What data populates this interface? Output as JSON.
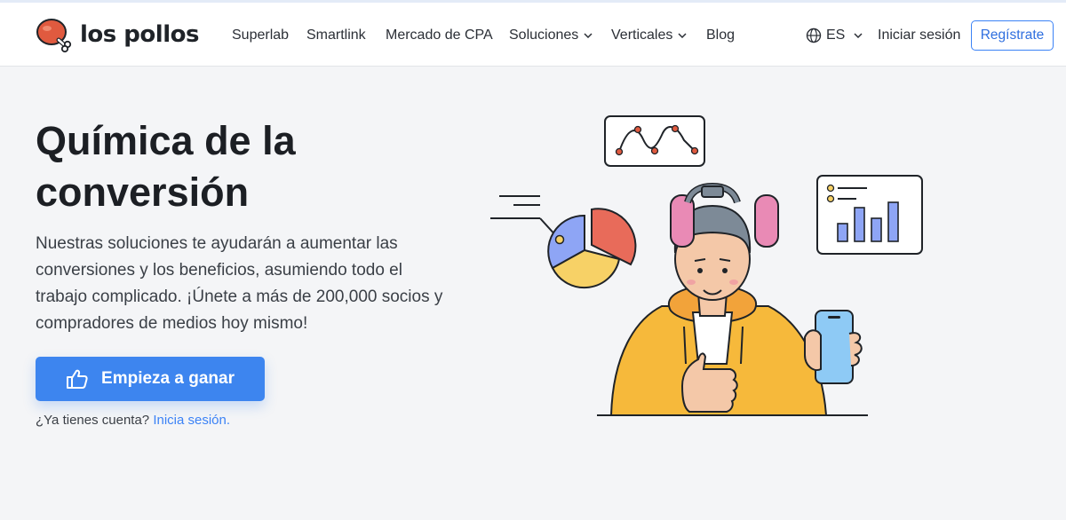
{
  "brand": {
    "name": "los pollos",
    "logo_icon": "chicken-leg-icon",
    "colors": {
      "logo_red": "#e05a3f",
      "accent_blue": "#3d85ef",
      "link_blue": "#3b82f6"
    }
  },
  "nav": {
    "items": [
      {
        "label": "Superlab",
        "has_dropdown": false
      },
      {
        "label": "Smartlink",
        "has_dropdown": false
      },
      {
        "label": "Mercado de CPA",
        "has_dropdown": false
      },
      {
        "label": "Soluciones",
        "has_dropdown": true
      },
      {
        "label": "Verticales",
        "has_dropdown": true
      },
      {
        "label": "Blog",
        "has_dropdown": false
      }
    ],
    "language": {
      "icon": "globe-icon",
      "label": "ES"
    },
    "login_label": "Iniciar sesión",
    "register_label": "Regístrate"
  },
  "hero": {
    "title": "Química de la conversión",
    "description": "Nuestras soluciones te ayudarán a aumentar las conversiones y los beneficios, asumiendo todo el trabajo complicado. ¡Únete a más de 200,000 socios y compradores de medios hoy mismo!",
    "cta_label": "Empieza a ganar",
    "cta_icon": "thumbs-up-icon",
    "account_prompt": "¿Ya tienes cuenta?",
    "account_link": "Inicia sesión.",
    "illustration": "person-with-goggles-thumbs-up-illustration"
  }
}
